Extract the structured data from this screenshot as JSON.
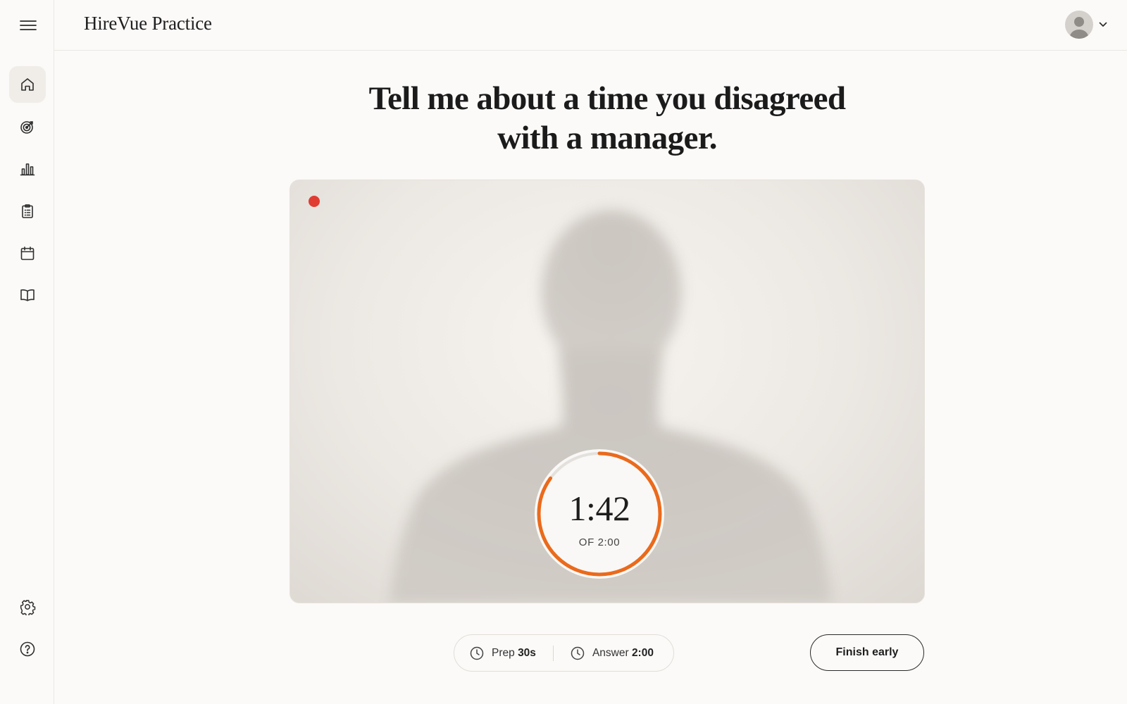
{
  "header": {
    "brand": "HireVue Practice"
  },
  "sidebar": {
    "items": [
      {
        "name": "home",
        "icon": "home-icon"
      },
      {
        "name": "target",
        "icon": "target-icon"
      },
      {
        "name": "analytics",
        "icon": "bar-chart-icon"
      },
      {
        "name": "clipboard",
        "icon": "clipboard-icon"
      },
      {
        "name": "calendar",
        "icon": "calendar-icon"
      },
      {
        "name": "library",
        "icon": "book-icon"
      }
    ],
    "bottom": [
      {
        "name": "settings",
        "icon": "gear-icon"
      },
      {
        "name": "help",
        "icon": "help-icon"
      }
    ]
  },
  "question": {
    "line1": "Tell me about a time you disagreed",
    "line2": "with a manager."
  },
  "recording": {
    "indicator_color": "#e03c31",
    "timer_value": "1:42",
    "timer_total": "OF 2:00",
    "progress_fraction": 0.85,
    "accent_color": "#ea6a1c"
  },
  "controls": {
    "prep_label": "Prep",
    "prep_value": "30s",
    "answer_label": "Answer",
    "answer_value": "2:00",
    "finish_label": "Finish early"
  }
}
